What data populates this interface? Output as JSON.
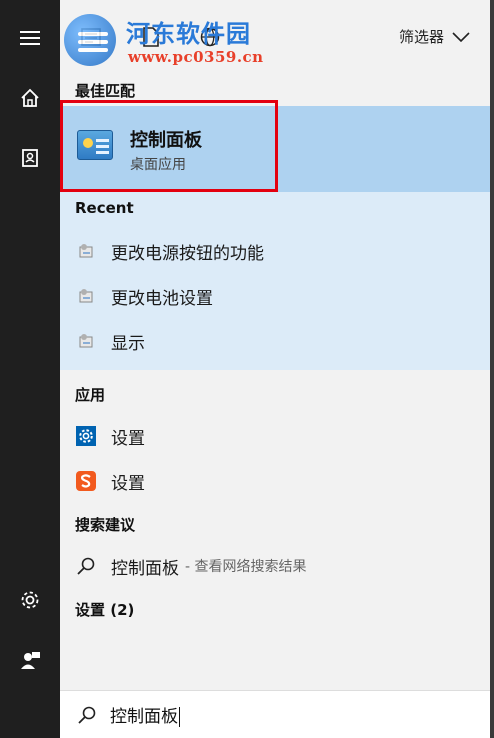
{
  "watermark": {
    "title": "河东软件园",
    "subtitle": "www.pc0359.cn"
  },
  "topbar": {
    "filter_label": "筛选器"
  },
  "sections": {
    "best_match": "最佳匹配",
    "recent": "Recent",
    "apps": "应用",
    "search_suggestions": "搜索建议",
    "settings": "设置 (2)"
  },
  "best_match": {
    "title": "控制面板",
    "subtitle": "桌面应用"
  },
  "recent": [
    {
      "label": "更改电源按钮的功能"
    },
    {
      "label": "更改电池设置"
    },
    {
      "label": "显示"
    }
  ],
  "apps": [
    {
      "label": "设置",
      "icon": "gear-icon"
    },
    {
      "label": "设置",
      "icon": "sogou-icon"
    }
  ],
  "suggestion": {
    "label": "控制面板",
    "hint": "- 查看网络搜索结果"
  },
  "search": {
    "value": "控制面板"
  },
  "colors": {
    "highlight": "#aed2f0",
    "recent_bg": "#dcebf8",
    "redbox": "#e3000f",
    "accent": "#0063b1"
  }
}
